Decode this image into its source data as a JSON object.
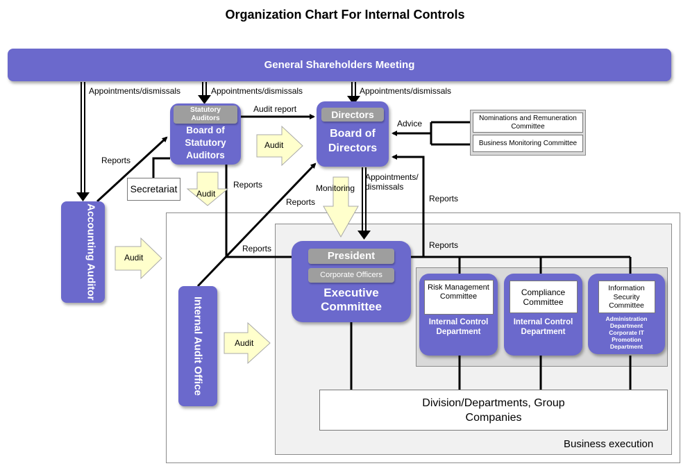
{
  "title": "Organization Chart For Internal Controls",
  "colors": {
    "node_purple": "#6b69cc",
    "tag_gray": "#9e9e9e",
    "audit_arrow_fill": "#ffffcc",
    "panel_gray": "#f1f1f1",
    "panel_dark_gray": "#d9d9d9"
  },
  "nodes": {
    "general_shareholders_meeting": "General Shareholders Meeting",
    "board_statutory_auditors": {
      "tag": "Statutory Auditors",
      "title": "Board of Statutory Auditors"
    },
    "board_of_directors": {
      "tag": "Directors",
      "title": "Board of Directors"
    },
    "accounting_auditor": "Accounting Auditor",
    "secretariat": "Secretariat",
    "internal_audit_office": "Internal Audit Office",
    "executive_committee": {
      "tag_president": "President",
      "tag_officers": "Corporate Officers",
      "title": "Executive Committee"
    },
    "advisory_committees": [
      "Nominations and Remuneration Committee",
      "Business Monitoring Committee"
    ],
    "departments": [
      {
        "committee": "Risk Management Committee",
        "department": "Internal Control Department"
      },
      {
        "committee": "Compliance Committee",
        "department": "Internal Control Department"
      },
      {
        "committee": "Information Security Committee",
        "department": "Administration Department Corporate IT Promotion Department"
      }
    ],
    "division_group": "Division/Departments, Group Companies",
    "business_execution": "Business execution"
  },
  "edge_labels": {
    "appt_accounting": "Appointments/dismissals",
    "appt_statutory": "Appointments/dismissals",
    "appt_directors": "Appointments/dismissals",
    "audit_report": "Audit report",
    "advice": "Advice",
    "reports_acct_to_statutory": "Reports",
    "reports_iao_to_statutory": "Reports",
    "reports_iao_to_directors": "Reports",
    "reports_iao_to_president": "Reports",
    "reports_committees_to_directors": "Reports",
    "reports_committees_to_president": "Reports",
    "monitoring": "Monitoring",
    "appt_president_l1": "Appointments/",
    "appt_president_l2": "dismissals",
    "audit_statutory_to_directors": "Audit",
    "audit_statutory_down": "Audit",
    "audit_accounting": "Audit",
    "audit_iao": "Audit"
  }
}
